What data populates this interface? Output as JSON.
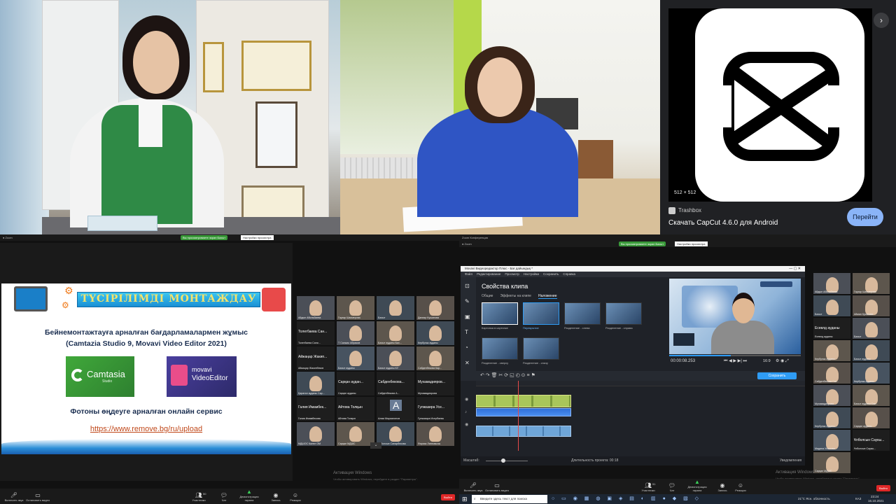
{
  "q3": {
    "share_notice": "Вы просматриваете экран Бахыт",
    "view_options": "Настройки просмотра",
    "slide": {
      "title": "ТҮСІРІЛІМДІ МОНТАЖДАУ",
      "line1": "Бейнемонтажтауға арналған бағдарламалармен жұмыс",
      "line2": "(Camtazia Studio 9,  Movavi Video Editor 2021)",
      "camtasia": "Camtasia",
      "camtasia_sub": "Studio",
      "movavi_top": "movavi",
      "movavi_bottom": "VideoEditor",
      "line3": "Фотоны өңдеуге арналған онлайн сервис",
      "link": "https://www.remove.bg/ru/upload"
    },
    "gallery": [
      {
        "name": "Айдын Абильбаева"
      },
      {
        "name": "Гаухар Шахмерова"
      },
      {
        "name": "Бахыт"
      },
      {
        "name": "Данияр Кушанова"
      },
      {
        "name": "Толегбаева Сани...",
        "big": "Толегбаева  Сан..."
      },
      {
        "name": "Т Салжас Абрасов"
      },
      {
        "name": "Бахыт ауданы Бах..."
      },
      {
        "name": "Кербулак ауданы"
      },
      {
        "name": "Айжаңар Жакипбеков",
        "big": "Айжаңар  Жакип..."
      },
      {
        "name": "Бахыт ауданы"
      },
      {
        "name": "Бахыт ауданы КУ"
      },
      {
        "name": "Сабденбекова Кар..."
      },
      {
        "name": "Қаратал ауданы Сар..."
      },
      {
        "name": "Сарқан ауданы",
        "big": "Сарқан  аудан..."
      },
      {
        "name": "Сабденбекова А...",
        "big": "Сабденбекова..."
      },
      {
        "name": "Мухамадиярова",
        "big": "Мухамадияров..."
      },
      {
        "name": "Галия Имамбекова",
        "big": "Галия  Имамбек..."
      },
      {
        "name": "Айтова Толқын",
        "big": "Айтова  Толқын"
      },
      {
        "name": "Алим Мырзалинов",
        "big": "A"
      },
      {
        "name": "Гулжазира Исербаева",
        "big": "Гулжазира  Усе..."
      },
      {
        "name": "МДШОС Калпе ОМ"
      },
      {
        "name": "Сарқан МДШС"
      },
      {
        "name": "Ұлболсын Сапарбекова"
      },
      {
        "name": "Фариза Латимкызы"
      }
    ],
    "toolbar": [
      "Включить звук",
      "Остановить видео",
      "Участники",
      "Чат",
      "Демонстрация экрана",
      "Запись",
      "Реакции"
    ],
    "participants_count": "50",
    "end": "Выйти"
  },
  "q4": {
    "zoom_title": "Zoom Конференция",
    "share_notice": "Вы просматриваете экран Бахыт",
    "view_options": "Настройки просмотра",
    "mv_title": "Movavi Видеоредактор Плюс - Бағ дайындық *",
    "menu": [
      "Файл",
      "Редактирование",
      "Просмотр",
      "Настройки",
      "Сохранить",
      "Справка"
    ],
    "panel_title": "Свойства клипа",
    "tabs": [
      "Общие",
      "Эффекты на клипе",
      "Наложение"
    ],
    "thumbs": [
      "Картинка в картинке",
      "Перекрытие",
      "Разделение - слева",
      "Разделение - справа",
      "Разделение - сверху",
      "Разделение - снизу"
    ],
    "timecode": "00:00:08.253",
    "ratio": "16:9",
    "save_btn": "Сохранить",
    "scale_label": "Масштаб:",
    "duration": "Длительность проекта: 00:18",
    "notify": "Уведомления",
    "gallery": [
      {
        "name": "Айдын Абильбаева"
      },
      {
        "name": "Гаухар Шахмерова"
      },
      {
        "name": "Бахыт"
      },
      {
        "name": "Айман Кусанова"
      },
      {
        "name": "Есевлд ауданы",
        "big": "Есевлд  ауданы"
      },
      {
        "name": "Бахыт"
      },
      {
        "name": "Кербулак ауданы"
      },
      {
        "name": "Бахыт ауданы"
      },
      {
        "name": "Сабденбекова Сат..."
      },
      {
        "name": "Кербулак ауданы"
      },
      {
        "name": "Мухамадиярова"
      },
      {
        "name": "Бахыт ауданы Сан..."
      },
      {
        "name": "Кербулак ауданы"
      },
      {
        "name": "Сарқан ауданы"
      },
      {
        "name": "Мадина Уламова"
      },
      {
        "name": "Ұлболсын Саукы...",
        "big": "Ұлболсын  Саукы..."
      },
      {
        "name": "Сарқан МДШС"
      }
    ],
    "toolbar": [
      "Включить звук",
      "Остановить видео",
      "Участники",
      "Чат",
      "Демонстрация экрана",
      "Запись",
      "Реакции"
    ],
    "participants_count": "51",
    "end": "Выйти",
    "watermark1": "Активация Windows",
    "watermark2": "Чтобы активировать Windows, перейдите в раздел \"Параметры\".",
    "taskbar_search": "Введите здесь текст для поиска",
    "weather": "21°C Ясн. облачность",
    "lang": "КАЗ",
    "clock_time": "23:24",
    "clock_date": "16.10.2021"
  },
  "q2": {
    "app_title": "Скачать CapCut 4.6.0 для Android",
    "source": "Trashbox",
    "size_badge": "512 × 512",
    "button": "Перейти"
  },
  "watermark_q3": {
    "line1": "Активация Windows",
    "line2": "Чтобы активировать Windows, перейдите в раздел \"Параметры\"."
  }
}
